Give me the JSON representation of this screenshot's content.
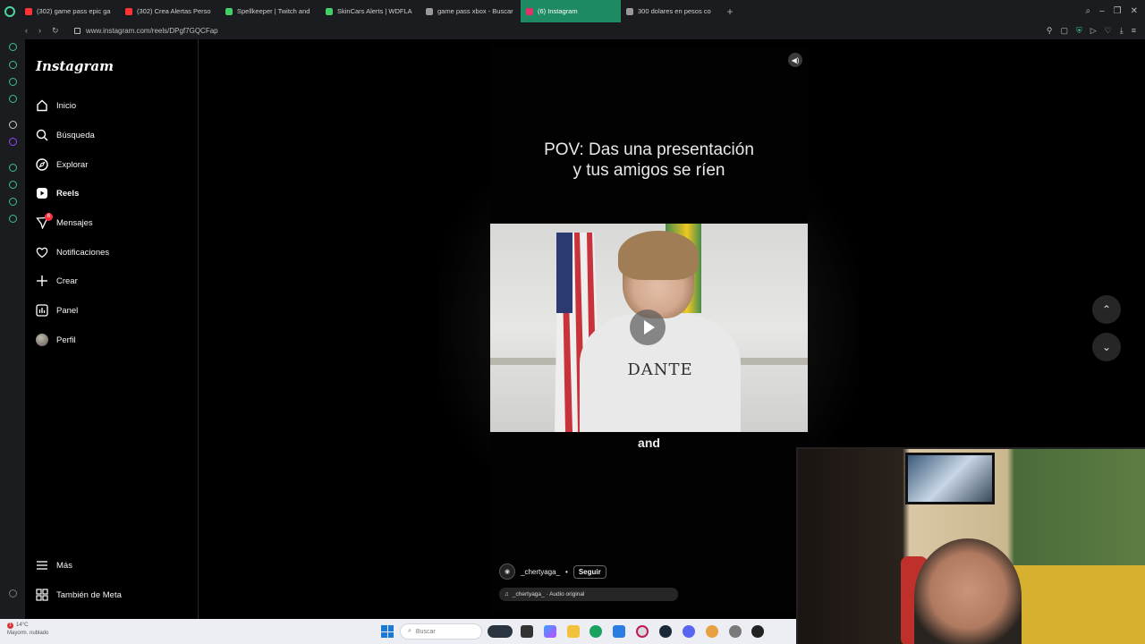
{
  "browser": {
    "tabs": [
      {
        "label": "(302) game pass epic ga",
        "icon_color": "#ff3333"
      },
      {
        "label": "(302) Crea Alertas Perso",
        "icon_color": "#ff3333"
      },
      {
        "label": "Spellkeeper | Twitch and",
        "icon_color": "#44cc66"
      },
      {
        "label": "SkinCars Alerts | WDFLA",
        "icon_color": "#44cc66"
      },
      {
        "label": "game pass xbox - Buscar",
        "icon_color": "#999999"
      },
      {
        "label": "(6) Instagram",
        "icon_color": "#e1306c"
      },
      {
        "label": "300 dolares en pesos co",
        "icon_color": "#999999"
      }
    ],
    "active_tab_index": 5,
    "url": "www.instagram.com/reels/DPgf7GQCFap"
  },
  "instagram": {
    "logo": "Instagram",
    "nav": {
      "home": "Inicio",
      "search": "Búsqueda",
      "explore": "Explorar",
      "reels": "Reels",
      "messages": "Mensajes",
      "messages_badge": "6",
      "notifications": "Notificaciones",
      "create": "Crear",
      "dashboard": "Panel",
      "profile": "Perfil",
      "more": "Más",
      "meta": "También de Meta"
    },
    "reel": {
      "caption_line1": "POV: Das una presentación",
      "caption_line2": "y tus amigos se ríen",
      "shirt_text": "DANTE",
      "subtitle": "and",
      "username": "_chertyaga_",
      "follow_label": "Seguir",
      "audio": "_chertyaga_ · Audio original"
    }
  },
  "taskbar": {
    "weather_temp": "14°C",
    "weather_desc": "Mayorm. nublado",
    "weather_badge": "1",
    "search_placeholder": "Buscar"
  },
  "colors": {
    "accent_tab": "#1e8a62",
    "opera_green": "#3fbf8f",
    "badge_red": "#ff3040"
  }
}
